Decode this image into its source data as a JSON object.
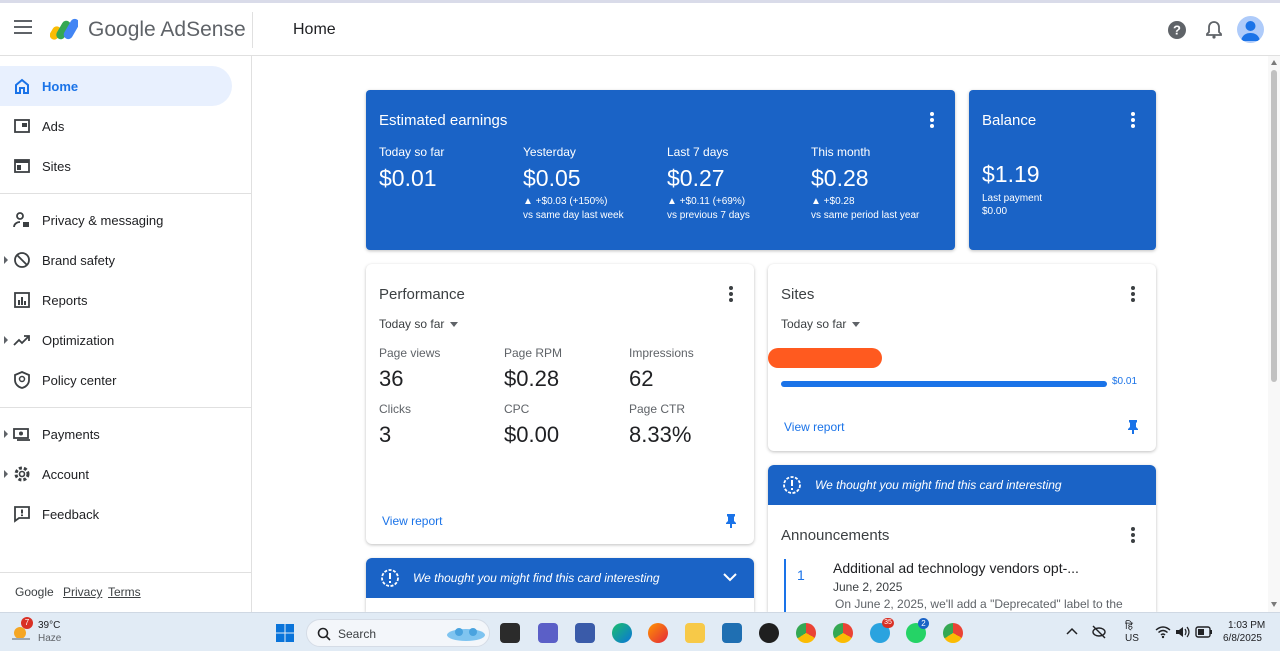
{
  "app": {
    "brand": "Google AdSense",
    "page_title": "Home"
  },
  "sidebar": {
    "items": [
      {
        "label": "Home"
      },
      {
        "label": "Ads"
      },
      {
        "label": "Sites"
      },
      {
        "label": "Privacy & messaging"
      },
      {
        "label": "Brand safety"
      },
      {
        "label": "Reports"
      },
      {
        "label": "Optimization"
      },
      {
        "label": "Policy center"
      },
      {
        "label": "Payments"
      },
      {
        "label": "Account"
      },
      {
        "label": "Feedback"
      }
    ],
    "footer": {
      "google": "Google",
      "privacy": "Privacy",
      "terms": "Terms"
    }
  },
  "earnings": {
    "title": "Estimated earnings",
    "cols": [
      {
        "label": "Today so far",
        "value": "$0.01",
        "change": "",
        "compare": ""
      },
      {
        "label": "Yesterday",
        "value": "$0.05",
        "change": "▲ +$0.03 (+150%)",
        "compare": "vs same day last week"
      },
      {
        "label": "Last 7 days",
        "value": "$0.27",
        "change": "▲ +$0.11 (+69%)",
        "compare": "vs previous 7 days"
      },
      {
        "label": "This month",
        "value": "$0.28",
        "change": "▲ +$0.28",
        "compare": "vs same period last year"
      }
    ]
  },
  "balance": {
    "title": "Balance",
    "value": "$1.19",
    "last_label": "Last payment",
    "last_value": "$0.00"
  },
  "performance": {
    "title": "Performance",
    "range": "Today so far",
    "metrics": [
      {
        "label": "Page views",
        "value": "36"
      },
      {
        "label": "Page RPM",
        "value": "$0.28"
      },
      {
        "label": "Impressions",
        "value": "62"
      },
      {
        "label": "Clicks",
        "value": "3"
      },
      {
        "label": "CPC",
        "value": "$0.00"
      },
      {
        "label": "Page CTR",
        "value": "8.33%"
      }
    ],
    "link": "View report"
  },
  "sites": {
    "title": "Sites",
    "range": "Today so far",
    "bar_value": "$0.01",
    "bar_fraction": 1.0,
    "link": "View report"
  },
  "interesting": {
    "text": "We thought you might find this card interesting"
  },
  "announcements": {
    "title": "Announcements",
    "number": "1",
    "headline": "Additional ad technology vendors opt-...",
    "date": "June 2, 2025",
    "snippet": "On June 2, 2025, we'll add a \"Deprecated\" label to the"
  },
  "taskbar": {
    "weather_temp": "39°C",
    "weather_desc": "Haze",
    "weather_badge": "7",
    "search": "Search",
    "lang_top": "हि",
    "lang_bottom": "US",
    "time": "1:03 PM",
    "date": "6/8/2025",
    "badges": {
      "telegram": "35",
      "whatsapp": "2"
    }
  },
  "colors": {
    "primary": "#1a63c6",
    "link": "#1a73e8",
    "redaction": "#ff5a1f"
  }
}
